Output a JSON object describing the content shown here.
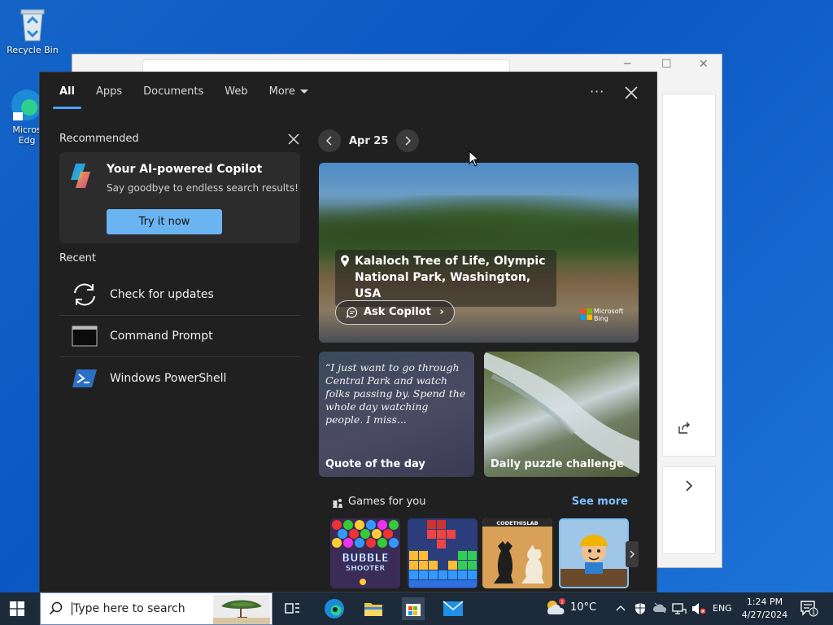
{
  "desktop": {
    "recycle_bin_label": "Recycle Bin",
    "edge_label_1": "Micros",
    "edge_label_2": "Edg"
  },
  "flyout": {
    "tabs": [
      {
        "label": "All",
        "active": true
      },
      {
        "label": "Apps"
      },
      {
        "label": "Documents"
      },
      {
        "label": "Web"
      },
      {
        "label": "More"
      }
    ],
    "recommended_label": "Recommended",
    "copilot": {
      "title": "Your AI-powered Copilot",
      "subtitle": "Say goodbye to endless search results!",
      "button": "Try it now"
    },
    "recent_label": "Recent",
    "recent": [
      {
        "label": "Check for updates",
        "icon": "sync-icon"
      },
      {
        "label": "Command Prompt",
        "icon": "cmd-icon"
      },
      {
        "label": "Windows PowerShell",
        "icon": "powershell-icon"
      }
    ],
    "date": "Apr 25",
    "hero": {
      "location": "Kalaloch Tree of Life, Olympic National Park, Washington, USA",
      "ask_button": "Ask Copilot",
      "brand_1": "Microsoft",
      "brand_2": "Bing"
    },
    "quote": {
      "text": "“I just want to go through Central Park and watch folks passing by. Spend the whole day watching people. I miss...",
      "caption": "Quote of the day"
    },
    "puzzle_caption": "Daily puzzle challenge",
    "games": {
      "title": "Games for you",
      "see_more": "See more",
      "bubble_title_1": "BUBBLE",
      "bubble_title_2": "SHOOTER",
      "chess_brand": "CODETHISLAB"
    }
  },
  "taskbar": {
    "search_placeholder": "Type here to search",
    "temperature": "10°C",
    "language": "ENG",
    "time": "1:24 PM",
    "date": "4/27/2024",
    "notification_count": "1",
    "weather_badge": "1"
  },
  "colors": {
    "accent": "#4ca3ff",
    "copilot_button": "#6ab4f2",
    "flyout_bg": "#202020",
    "link": "#7ec0ff",
    "taskbar": "#1c2a39"
  }
}
